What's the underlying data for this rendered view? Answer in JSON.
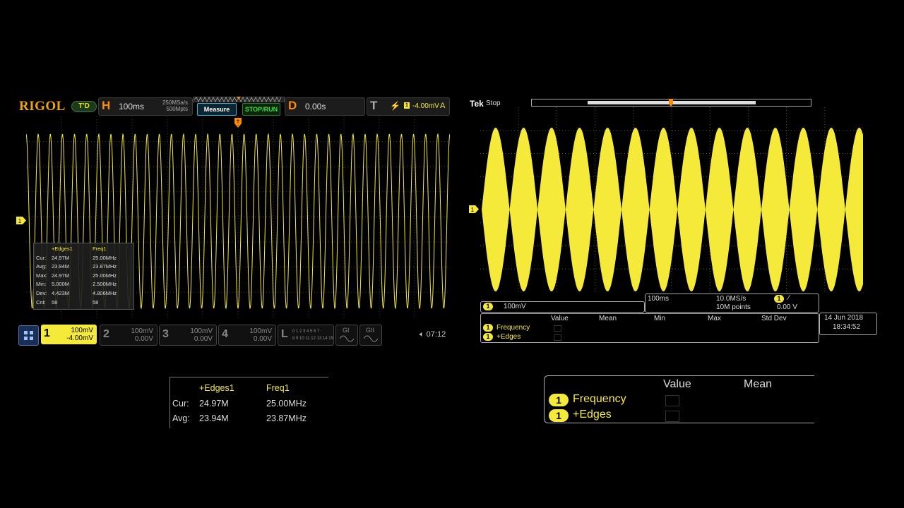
{
  "rigol": {
    "logo": "RIGOL",
    "badge": "T'D",
    "horizontal": {
      "letter": "H",
      "timebase": "100ms",
      "sample_rate": "250MSa/s",
      "mem_depth": "500Mpts"
    },
    "buttons": {
      "measure": "Measure",
      "stop_run": "STOP/RUN"
    },
    "delay": {
      "letter": "D",
      "value": "0.00s"
    },
    "trigger": {
      "letter": "T",
      "level": "-4.00mV",
      "source": "A"
    },
    "measurement": {
      "headers": [
        "+Edges1",
        "Freq1"
      ],
      "rows": [
        {
          "label": "Cur:",
          "v1": "24.97M",
          "v2": "25.00MHz"
        },
        {
          "label": "Avg:",
          "v1": "23.94M",
          "v2": "23.87MHz"
        },
        {
          "label": "Max:",
          "v1": "24.97M",
          "v2": "25.00MHz"
        },
        {
          "label": "Min:",
          "v1": "5.000M",
          "v2": "2.500MHz"
        },
        {
          "label": "Dev:",
          "v1": "4.423M",
          "v2": "4.806MHz"
        },
        {
          "label": "Cnt:",
          "v1": "58",
          "v2": "58"
        }
      ]
    },
    "channels": [
      {
        "num": "1",
        "scale": "100mV",
        "offset": "-4.00mV"
      },
      {
        "num": "2",
        "scale": "100mV",
        "offset": "0.00V"
      },
      {
        "num": "3",
        "scale": "100mV",
        "offset": "0.00V"
      },
      {
        "num": "4",
        "scale": "100mV",
        "offset": "0.00V"
      }
    ],
    "logic": {
      "letter": "L",
      "row1": "0 1 2 3 4 5 6 7",
      "row2": "8 9 10 11 12 13 14 15"
    },
    "gen": [
      "GI",
      "GII"
    ],
    "clock": "07:12"
  },
  "rigol_zoom": {
    "headers": [
      "+Edges1",
      "Freq1"
    ],
    "rows": [
      {
        "label": "Cur:",
        "v1": "24.97M",
        "v2": "25.00MHz"
      },
      {
        "label": "Avg:",
        "v1": "23.94M",
        "v2": "23.87MHz"
      }
    ]
  },
  "tek": {
    "logo": "Tek",
    "status": "Stop",
    "ch_scale": "100mV",
    "ch_num": "1",
    "timebase": "100ms",
    "sample_rate": "10.0MS/s",
    "record": "10M points",
    "trig_level": "0.00 V",
    "meas_headers": [
      "Value",
      "Mean",
      "Min",
      "Max",
      "Std Dev"
    ],
    "meas_rows": [
      "Frequency",
      "+Edges"
    ],
    "date": "14 Jun  2018",
    "time": "18:34:52"
  },
  "tek_zoom": {
    "headers": [
      "Value",
      "Mean"
    ],
    "rows": [
      "Frequency",
      "+Edges"
    ]
  },
  "colors": {
    "trace": "#f5ea3a",
    "rigol_orange": "#ff8c00",
    "grid": "#3a3a3a"
  }
}
